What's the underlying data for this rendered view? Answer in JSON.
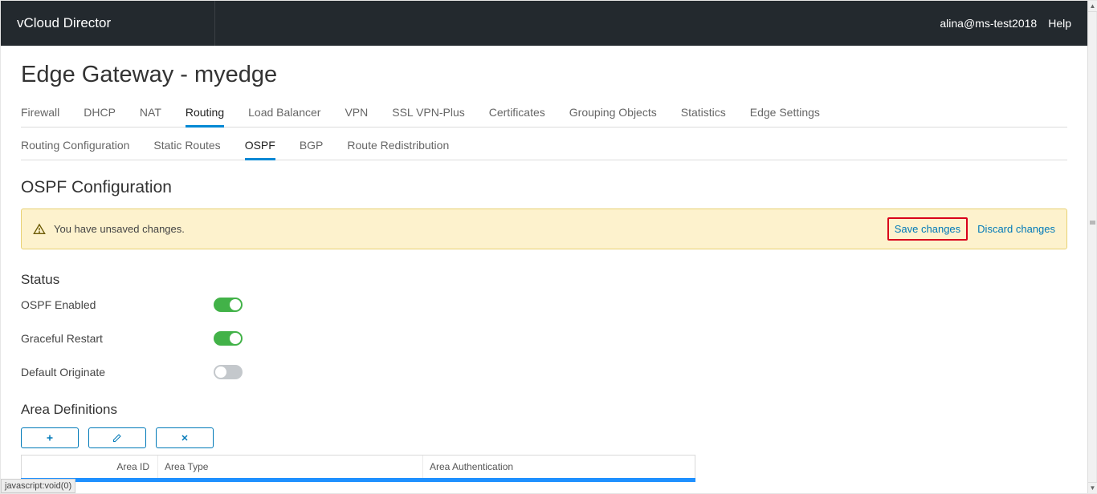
{
  "header": {
    "app_name": "vCloud Director",
    "user": "alina@ms-test2018",
    "help": "Help"
  },
  "page": {
    "title": "Edge Gateway - myedge",
    "section": "OSPF Configuration",
    "status_heading": "Status",
    "area_heading": "Area Definitions"
  },
  "tabs": {
    "items": [
      "Firewall",
      "DHCP",
      "NAT",
      "Routing",
      "Load Balancer",
      "VPN",
      "SSL VPN-Plus",
      "Certificates",
      "Grouping Objects",
      "Statistics",
      "Edge Settings"
    ],
    "active": "Routing"
  },
  "subtabs": {
    "items": [
      "Routing Configuration",
      "Static Routes",
      "OSPF",
      "BGP",
      "Route Redistribution"
    ],
    "active": "OSPF"
  },
  "alert": {
    "message": "You have unsaved changes.",
    "save": "Save changes",
    "discard": "Discard changes"
  },
  "settings": {
    "ospf_enabled": {
      "label": "OSPF Enabled",
      "value": true
    },
    "graceful_restart": {
      "label": "Graceful Restart",
      "value": true
    },
    "default_originate": {
      "label": "Default Originate",
      "value": false
    }
  },
  "table": {
    "columns": [
      "Area ID",
      "Area Type",
      "Area Authentication"
    ]
  },
  "statusbar": {
    "text": "javascript:void(0)"
  }
}
